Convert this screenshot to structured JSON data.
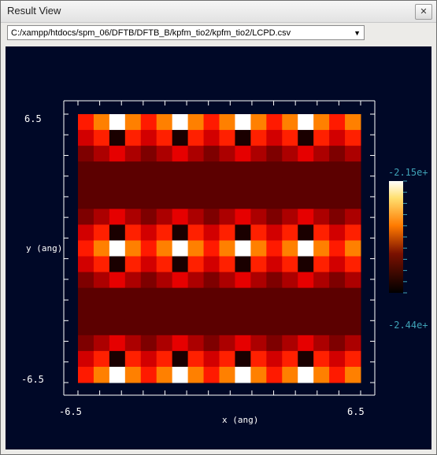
{
  "window": {
    "title": "Result View",
    "close_icon": "close-icon"
  },
  "file_select": {
    "value": "C:/xampp/htdocs/spm_06/DFTB/DFTB_B/kpfm_tio2/kpfm_tio2/LCPD.csv",
    "arrow_icon": "chevron-down-icon"
  },
  "colors": {
    "background": "#000827",
    "axis": "#ffffff",
    "colorbar_labels": "#3fa3b8"
  },
  "chart_data": {
    "type": "heatmap",
    "xlabel": "x (ang)",
    "ylabel": "y (ang)",
    "x_ticks": [
      "-6.5",
      "6.5"
    ],
    "y_ticks": [
      "6.5",
      "-6.5"
    ],
    "xlim": [
      -6.5,
      6.5
    ],
    "ylim": [
      -6.5,
      6.5
    ],
    "colorbar": {
      "max_label": "-2.15e+",
      "min_label": "-2.44e+",
      "colormap": "afmhot"
    },
    "grid": {
      "cols": 18,
      "rows": 17,
      "base": 0.18,
      "col_profile": [
        0.55,
        0.75,
        1.0,
        0.75,
        0.55
      ],
      "row_profile": [
        0.45,
        0.75,
        1.0,
        0.75,
        0.45
      ],
      "peak_col_centers": [
        2,
        6,
        10,
        14,
        18
      ],
      "peak_row_centers": [
        0,
        8,
        16
      ],
      "dark_spot_rows": [
        1,
        7,
        15,
        9
      ]
    }
  }
}
